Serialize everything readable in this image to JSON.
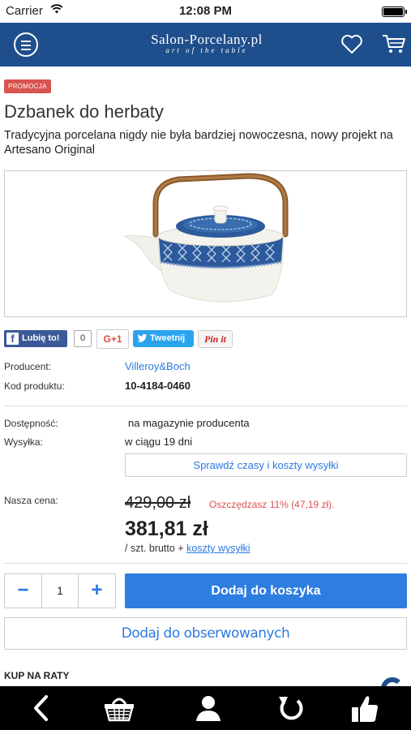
{
  "status": {
    "carrier": "Carrier",
    "time": "12:08 PM"
  },
  "header": {
    "logo_name": "Salon-Porcelany.pl",
    "logo_tag": "art of the table"
  },
  "product": {
    "badge": "PROMOCJA",
    "title": "Dzbanek do herbaty",
    "description": "Tradycyjna porcelana nigdy nie była bardziej nowoczesna, nowy projekt na Artesano Original"
  },
  "social": {
    "like_label": "Lubię to!",
    "like_count": "0",
    "gplus_label": "G+1",
    "tweet_label": "Tweetnij",
    "pin_label": "Pin it"
  },
  "details": {
    "producer_label": "Producent:",
    "producer_value": "Villeroy&Boch",
    "code_label": "Kod produktu:",
    "code_value": "10-4184-0460",
    "availability_label": "Dostępność:",
    "availability_value": "na magazynie producenta",
    "shipping_label": "Wysyłka:",
    "shipping_value": "w ciągu 19 dni",
    "check_button": "Sprawdź czasy i koszty wysyłki"
  },
  "pricing": {
    "label": "Nasza cena:",
    "old_price": "429,00 zł",
    "savings": "Oszczędzasz 11% (47,19 zł).",
    "price": "381,81 zł",
    "unit_text": "/ szt. brutto + ",
    "shipping_link": "koszty wysyłki"
  },
  "cart": {
    "quantity": "1",
    "minus": "−",
    "plus": "+",
    "add_button": "Dodaj do koszyka",
    "watch_button": "Dodaj do obserwowanych"
  },
  "installments": {
    "label": "KUP NA RATY"
  },
  "colors": {
    "header": "#1f4e8c",
    "accent": "#2e7de1",
    "promo": "#d9534f"
  },
  "toolbar": {
    "icons": [
      "back-icon",
      "basket-icon",
      "user-icon",
      "refresh-icon",
      "thumbs-up-icon"
    ]
  }
}
